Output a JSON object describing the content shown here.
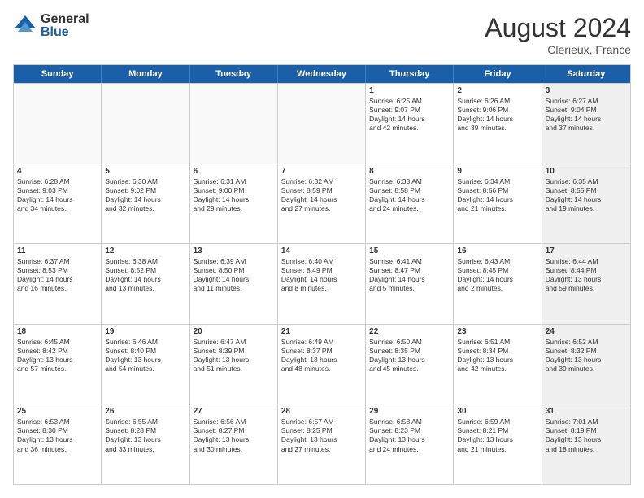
{
  "header": {
    "logo_general": "General",
    "logo_blue": "Blue",
    "month_title": "August 2024",
    "location": "Clerieux, France"
  },
  "days_of_week": [
    "Sunday",
    "Monday",
    "Tuesday",
    "Wednesday",
    "Thursday",
    "Friday",
    "Saturday"
  ],
  "rows": [
    [
      {
        "day": "",
        "empty": true
      },
      {
        "day": "",
        "empty": true
      },
      {
        "day": "",
        "empty": true
      },
      {
        "day": "",
        "empty": true
      },
      {
        "day": "1",
        "lines": [
          "Sunrise: 6:25 AM",
          "Sunset: 9:07 PM",
          "Daylight: 14 hours",
          "and 42 minutes."
        ]
      },
      {
        "day": "2",
        "lines": [
          "Sunrise: 6:26 AM",
          "Sunset: 9:06 PM",
          "Daylight: 14 hours",
          "and 39 minutes."
        ]
      },
      {
        "day": "3",
        "shaded": true,
        "lines": [
          "Sunrise: 6:27 AM",
          "Sunset: 9:04 PM",
          "Daylight: 14 hours",
          "and 37 minutes."
        ]
      }
    ],
    [
      {
        "day": "4",
        "lines": [
          "Sunrise: 6:28 AM",
          "Sunset: 9:03 PM",
          "Daylight: 14 hours",
          "and 34 minutes."
        ]
      },
      {
        "day": "5",
        "lines": [
          "Sunrise: 6:30 AM",
          "Sunset: 9:02 PM",
          "Daylight: 14 hours",
          "and 32 minutes."
        ]
      },
      {
        "day": "6",
        "lines": [
          "Sunrise: 6:31 AM",
          "Sunset: 9:00 PM",
          "Daylight: 14 hours",
          "and 29 minutes."
        ]
      },
      {
        "day": "7",
        "lines": [
          "Sunrise: 6:32 AM",
          "Sunset: 8:59 PM",
          "Daylight: 14 hours",
          "and 27 minutes."
        ]
      },
      {
        "day": "8",
        "lines": [
          "Sunrise: 6:33 AM",
          "Sunset: 8:58 PM",
          "Daylight: 14 hours",
          "and 24 minutes."
        ]
      },
      {
        "day": "9",
        "lines": [
          "Sunrise: 6:34 AM",
          "Sunset: 8:56 PM",
          "Daylight: 14 hours",
          "and 21 minutes."
        ]
      },
      {
        "day": "10",
        "shaded": true,
        "lines": [
          "Sunrise: 6:35 AM",
          "Sunset: 8:55 PM",
          "Daylight: 14 hours",
          "and 19 minutes."
        ]
      }
    ],
    [
      {
        "day": "11",
        "lines": [
          "Sunrise: 6:37 AM",
          "Sunset: 8:53 PM",
          "Daylight: 14 hours",
          "and 16 minutes."
        ]
      },
      {
        "day": "12",
        "lines": [
          "Sunrise: 6:38 AM",
          "Sunset: 8:52 PM",
          "Daylight: 14 hours",
          "and 13 minutes."
        ]
      },
      {
        "day": "13",
        "lines": [
          "Sunrise: 6:39 AM",
          "Sunset: 8:50 PM",
          "Daylight: 14 hours",
          "and 11 minutes."
        ]
      },
      {
        "day": "14",
        "lines": [
          "Sunrise: 6:40 AM",
          "Sunset: 8:49 PM",
          "Daylight: 14 hours",
          "and 8 minutes."
        ]
      },
      {
        "day": "15",
        "lines": [
          "Sunrise: 6:41 AM",
          "Sunset: 8:47 PM",
          "Daylight: 14 hours",
          "and 5 minutes."
        ]
      },
      {
        "day": "16",
        "lines": [
          "Sunrise: 6:43 AM",
          "Sunset: 8:45 PM",
          "Daylight: 14 hours",
          "and 2 minutes."
        ]
      },
      {
        "day": "17",
        "shaded": true,
        "lines": [
          "Sunrise: 6:44 AM",
          "Sunset: 8:44 PM",
          "Daylight: 13 hours",
          "and 59 minutes."
        ]
      }
    ],
    [
      {
        "day": "18",
        "lines": [
          "Sunrise: 6:45 AM",
          "Sunset: 8:42 PM",
          "Daylight: 13 hours",
          "and 57 minutes."
        ]
      },
      {
        "day": "19",
        "lines": [
          "Sunrise: 6:46 AM",
          "Sunset: 8:40 PM",
          "Daylight: 13 hours",
          "and 54 minutes."
        ]
      },
      {
        "day": "20",
        "lines": [
          "Sunrise: 6:47 AM",
          "Sunset: 8:39 PM",
          "Daylight: 13 hours",
          "and 51 minutes."
        ]
      },
      {
        "day": "21",
        "lines": [
          "Sunrise: 6:49 AM",
          "Sunset: 8:37 PM",
          "Daylight: 13 hours",
          "and 48 minutes."
        ]
      },
      {
        "day": "22",
        "lines": [
          "Sunrise: 6:50 AM",
          "Sunset: 8:35 PM",
          "Daylight: 13 hours",
          "and 45 minutes."
        ]
      },
      {
        "day": "23",
        "lines": [
          "Sunrise: 6:51 AM",
          "Sunset: 8:34 PM",
          "Daylight: 13 hours",
          "and 42 minutes."
        ]
      },
      {
        "day": "24",
        "shaded": true,
        "lines": [
          "Sunrise: 6:52 AM",
          "Sunset: 8:32 PM",
          "Daylight: 13 hours",
          "and 39 minutes."
        ]
      }
    ],
    [
      {
        "day": "25",
        "lines": [
          "Sunrise: 6:53 AM",
          "Sunset: 8:30 PM",
          "Daylight: 13 hours",
          "and 36 minutes."
        ]
      },
      {
        "day": "26",
        "lines": [
          "Sunrise: 6:55 AM",
          "Sunset: 8:28 PM",
          "Daylight: 13 hours",
          "and 33 minutes."
        ]
      },
      {
        "day": "27",
        "lines": [
          "Sunrise: 6:56 AM",
          "Sunset: 8:27 PM",
          "Daylight: 13 hours",
          "and 30 minutes."
        ]
      },
      {
        "day": "28",
        "lines": [
          "Sunrise: 6:57 AM",
          "Sunset: 8:25 PM",
          "Daylight: 13 hours",
          "and 27 minutes."
        ]
      },
      {
        "day": "29",
        "lines": [
          "Sunrise: 6:58 AM",
          "Sunset: 8:23 PM",
          "Daylight: 13 hours",
          "and 24 minutes."
        ]
      },
      {
        "day": "30",
        "lines": [
          "Sunrise: 6:59 AM",
          "Sunset: 8:21 PM",
          "Daylight: 13 hours",
          "and 21 minutes."
        ]
      },
      {
        "day": "31",
        "shaded": true,
        "lines": [
          "Sunrise: 7:01 AM",
          "Sunset: 8:19 PM",
          "Daylight: 13 hours",
          "and 18 minutes."
        ]
      }
    ]
  ]
}
